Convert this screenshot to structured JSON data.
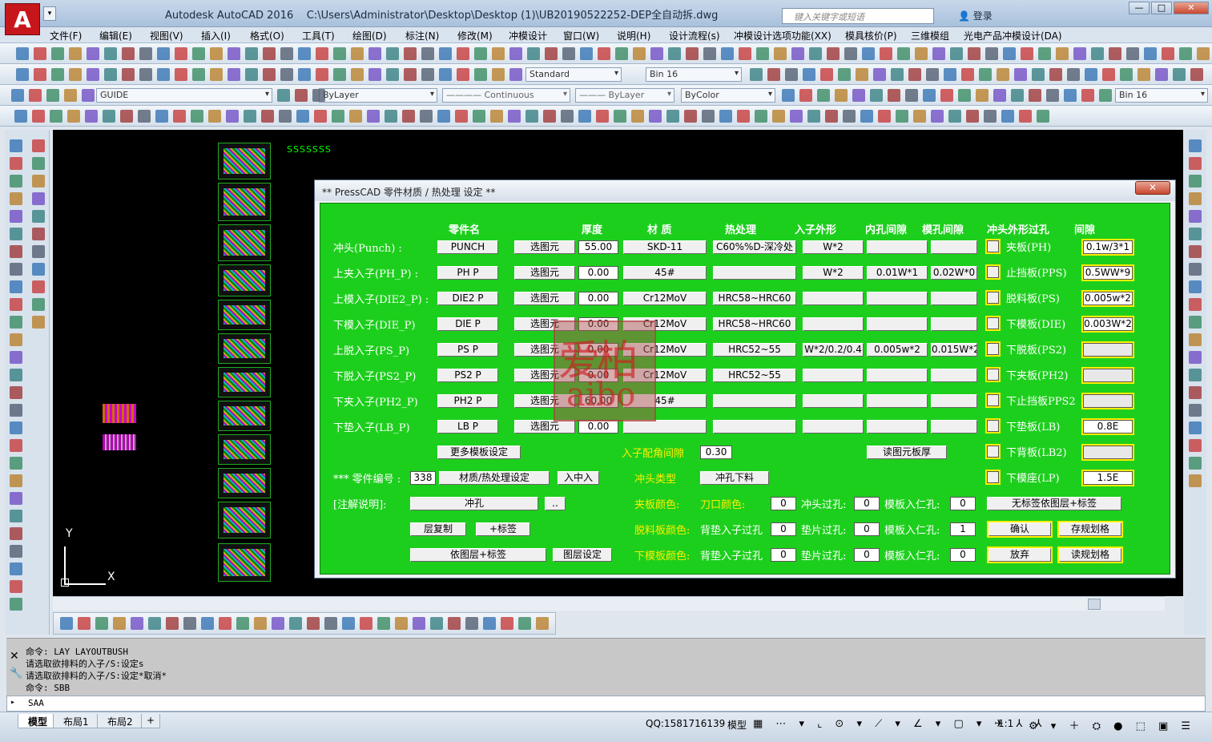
{
  "window": {
    "title": "Autodesk AutoCAD 2016",
    "file_path": "C:\\Users\\Administrator\\Desktop\\Desktop (1)\\UB20190522252-DEP全自动拆.dwg",
    "search_placeholder": "键入关键字或短语",
    "login": "登录",
    "logo_letter": "A"
  },
  "menu": [
    "文件(F)",
    "编辑(E)",
    "视图(V)",
    "插入(I)",
    "格式(O)",
    "工具(T)",
    "绘图(D)",
    "标注(N)",
    "修改(M)",
    "冲模设计",
    "窗口(W)",
    "说明(H)",
    "设计流程(s)",
    "冲模设计选项功能(XX)",
    "模具核价(P)",
    "三维模组",
    "光电产品冲模设计(DA)"
  ],
  "toolbar": {
    "textstyle": "Standard",
    "dimstyle": "Bin 16",
    "layer": "GUIDE",
    "color": "ByLayer",
    "linetype": "Continuous",
    "lineweight": "ByLayer",
    "plotstyle": "ByColor",
    "plotstyle2": "Bin 16"
  },
  "canvas": {
    "ucs_y": "Y",
    "ucs_x": "X",
    "topstrip": "SSSSSSS"
  },
  "dialog": {
    "title": "** PressCAD  零件材质 / 热处理 设定 **",
    "close": "✕",
    "headers": {
      "part": "零件名",
      "thickness": "厚度",
      "material": "材 质",
      "heat": "热处理",
      "shape": "入子外形",
      "inner_gap": "内孔间隙",
      "mold_gap": "模孔间隙",
      "punch_hole": "冲头外形过孔",
      "gap": "间隙"
    },
    "select_btn": "选图元",
    "rows": [
      {
        "label": "冲头(Punch) :",
        "part": "PUNCH",
        "thickness": "55.00",
        "material": "SKD-11",
        "heat": "C60%%D-深冷处",
        "shape": "W*2",
        "inner": "",
        "mold": "",
        "plate": "夹板(PH)",
        "gap": "0.1w/3*1"
      },
      {
        "label": "上夹入子(PH_P) :",
        "part": "PH  P",
        "thickness": "0.00",
        "material": "45#",
        "heat": "",
        "shape": "W*2",
        "inner": "0.01W*1",
        "mold": "0.02W*0",
        "plate": "止挡板(PPS)",
        "gap": "0.5WW*9"
      },
      {
        "label": "上模入子(DIE2_P) :",
        "part": "DIE2  P",
        "thickness": "0.00",
        "material": "Cr12MoV",
        "heat": "HRC58~HRC60",
        "shape": "",
        "inner": "",
        "mold": "",
        "plate": "脱料板(PS)",
        "gap": "0.005w*2"
      },
      {
        "label": "下模入子(DIE_P)",
        "part": "DIE  P",
        "thickness": "0.00",
        "material": "Cr12MoV",
        "heat": "HRC58~HRC60",
        "shape": "",
        "inner": "",
        "mold": "",
        "plate": "下模板(DIE)",
        "gap": "0.003W*2"
      },
      {
        "label": "上脱入子(PS_P)",
        "part": "PS  P",
        "thickness": "0.00",
        "material": "Cr12MoV",
        "heat": "HRC52~55",
        "shape": "W*2/0.2/0.4",
        "inner": "0.005w*2",
        "mold": "0.015W*2",
        "plate": "下脱板(PS2)",
        "gap": ""
      },
      {
        "label": "下脱入子(PS2_P)",
        "part": "PS2  P",
        "thickness": "0.00",
        "material": "Cr12MoV",
        "heat": "HRC52~55",
        "shape": "",
        "inner": "",
        "mold": "",
        "plate": "下夹板(PH2)",
        "gap": ""
      },
      {
        "label": "下夹入子(PH2_P)",
        "part": "PH2  P",
        "thickness": "60.00",
        "material": "45#",
        "heat": "",
        "shape": "",
        "inner": "",
        "mold": "",
        "plate": "下止挡板PPS2",
        "gap": ""
      },
      {
        "label": "下垫入子(LB_P)",
        "part": "LB  P",
        "thickness": "0.00",
        "material": "",
        "heat": "",
        "shape": "",
        "inner": "",
        "mold": "",
        "plate": "下垫板(LB)",
        "gap": "0.8E"
      }
    ],
    "extra_plates": [
      {
        "plate": "下背板(LB2)",
        "gap": ""
      },
      {
        "plate": "下模座(LP)",
        "gap": "1.5E"
      }
    ],
    "more_template": "更多模板设定",
    "corner_gap_label": "入子配角间隙",
    "corner_gap": "0.30",
    "read_thickness": "读图元板厚",
    "part_no_label": "*** 零件编号 :",
    "part_no": "338",
    "material_heat_btn": "材质/热处理设定",
    "insert_btn": "入中入",
    "punch_type_label": "冲头类型",
    "punch_type": "冲孔下料",
    "note_label": "[注解说明]:",
    "note_value": "冲孔",
    "note_more": "..",
    "layer_copy": "层复制",
    "add_label": "+标签",
    "by_layer_label": "依图层+标签",
    "layer_setting": "图层设定",
    "clamp_color": "夹板颜色:",
    "blade_color": "刀口颜色:",
    "blade_color_v": "0",
    "punch_hole": "冲头过孔:",
    "punch_hole_v": "0",
    "die_hole1": "模板入仁孔:",
    "die_hole1_v": "0",
    "strip_color": "脱料板颜色:",
    "back_hole1": "背垫入子过孔",
    "back_hole1_v": "0",
    "pad_hole1": "垫片过孔:",
    "pad_hole1_v": "0",
    "die_hole2": "模板入仁孔:",
    "die_hole2_v": "1",
    "lower_color": "下模板颜色:",
    "back_hole2": "背垫入子过孔",
    "back_hole2_v": "0",
    "pad_hole2": "垫片过孔:",
    "pad_hole2_v": "0",
    "die_hole3": "模板入仁孔:",
    "die_hole3_v": "0",
    "no_label_btn": "无标签依图层+标签",
    "ok": "确认",
    "save_rule": "存规划格",
    "cancel": "放弃",
    "read_rule": "读规划格"
  },
  "watermark": {
    "cn": "爱柏",
    "en": "aibo"
  },
  "command": {
    "lines": [
      "命令:  LAY  LAYOUTBUSH",
      "请选取欲排料的入子/S:设定s",
      "请选取欲排料的入子/S:设定*取消*",
      "命令:  SBB"
    ],
    "input": "SAA"
  },
  "status": {
    "tabs": [
      "模型",
      "布局1",
      "布局2"
    ],
    "add_tab": "+",
    "qq": "QQ:1581716139",
    "mode": "模型",
    "scale": "1:1"
  }
}
